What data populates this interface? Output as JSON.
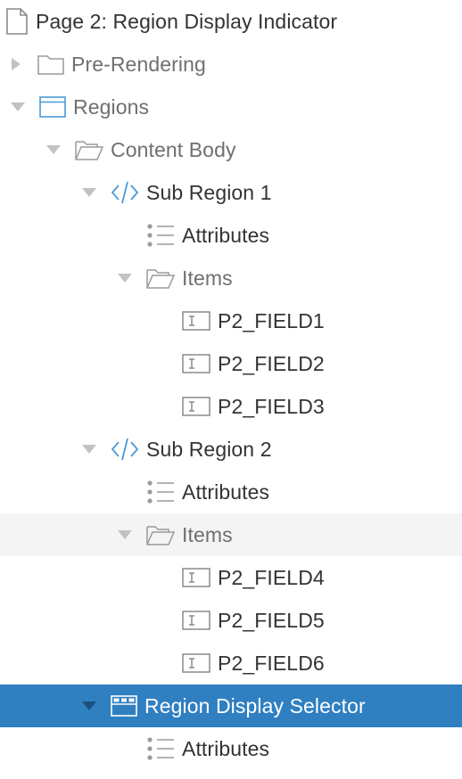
{
  "tree": {
    "page": {
      "label": "Page 2: Region Display Indicator",
      "icon": "page-icon"
    },
    "pre_rendering": {
      "label": "Pre-Rendering",
      "icon": "folder-icon",
      "expanded": false
    },
    "regions": {
      "label": "Regions",
      "icon": "region-icon",
      "expanded": true
    },
    "content_body": {
      "label": "Content Body",
      "icon": "folder-open-icon",
      "expanded": true
    },
    "sub_region_1": {
      "label": "Sub Region 1",
      "icon": "code-icon",
      "expanded": true,
      "attributes": {
        "label": "Attributes",
        "icon": "list-icon"
      },
      "items": {
        "label": "Items",
        "icon": "folder-open-icon",
        "expanded": true
      },
      "fields": [
        "P2_FIELD1",
        "P2_FIELD2",
        "P2_FIELD3"
      ]
    },
    "sub_region_2": {
      "label": "Sub Region 2",
      "icon": "code-icon",
      "expanded": true,
      "attributes": {
        "label": "Attributes",
        "icon": "list-icon"
      },
      "items": {
        "label": "Items",
        "icon": "folder-open-icon",
        "expanded": true
      },
      "fields": [
        "P2_FIELD4",
        "P2_FIELD5",
        "P2_FIELD6"
      ]
    },
    "region_display_selector": {
      "label": "Region Display Selector",
      "icon": "region-display-selector-icon",
      "expanded": true,
      "attributes": {
        "label": "Attributes",
        "icon": "list-icon"
      }
    }
  },
  "colors": {
    "selected_bg": "#2f7fc1",
    "hover_bg": "#f4f4f4",
    "accent_icon": "#4a9ad8",
    "text": "#333333"
  }
}
